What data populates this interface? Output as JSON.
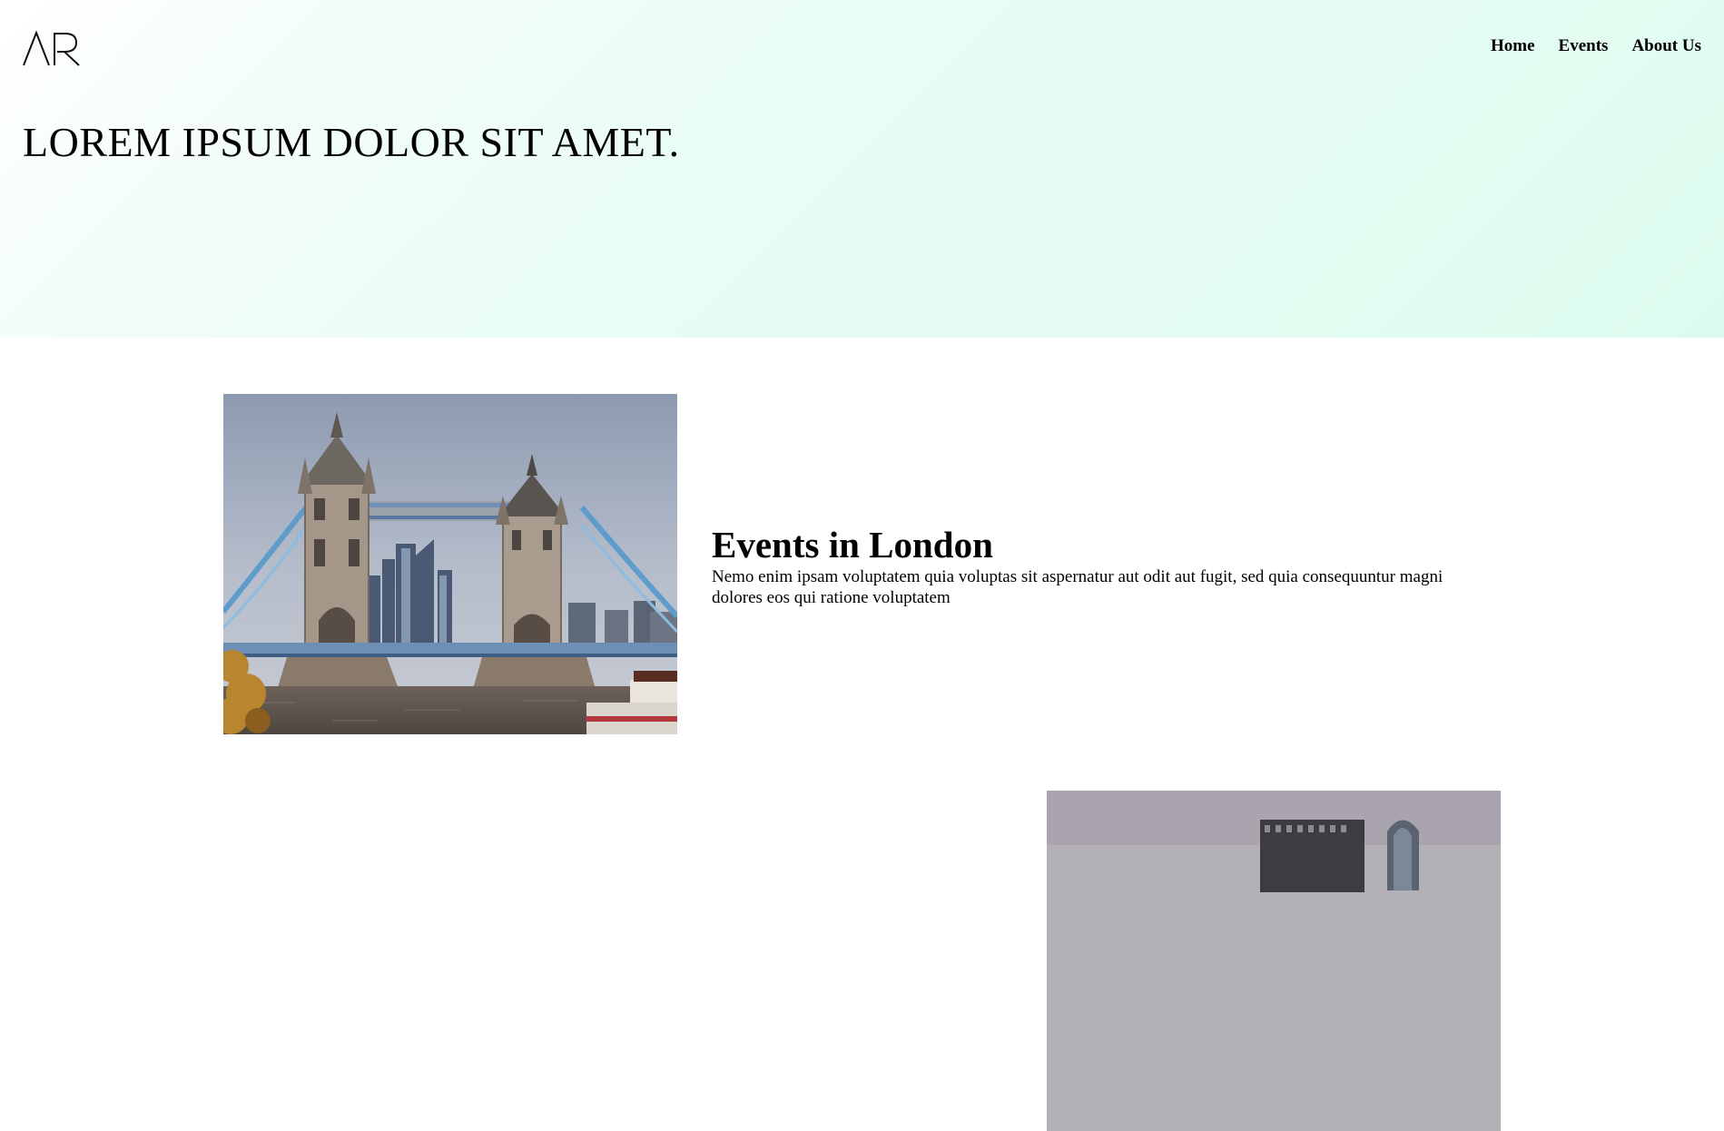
{
  "header": {
    "logo_text": "AR",
    "nav": {
      "home": "Home",
      "events": "Events",
      "about": "About Us"
    }
  },
  "hero": {
    "title": "LOREM IPSUM DOLOR SIT AMET."
  },
  "events": [
    {
      "title": "Events in London",
      "description": "Nemo enim ipsam voluptatem quia voluptas sit aspernatur aut odit aut fugit, sed quia consequuntur magni dolores eos qui ratione voluptatem",
      "image": "tower-bridge-photo"
    },
    {
      "image": "city-skyline-photo"
    }
  ],
  "colors": {
    "hero_gradient_start": "#ffffff",
    "hero_gradient_end": "#dcfbee",
    "text": "#000000"
  }
}
